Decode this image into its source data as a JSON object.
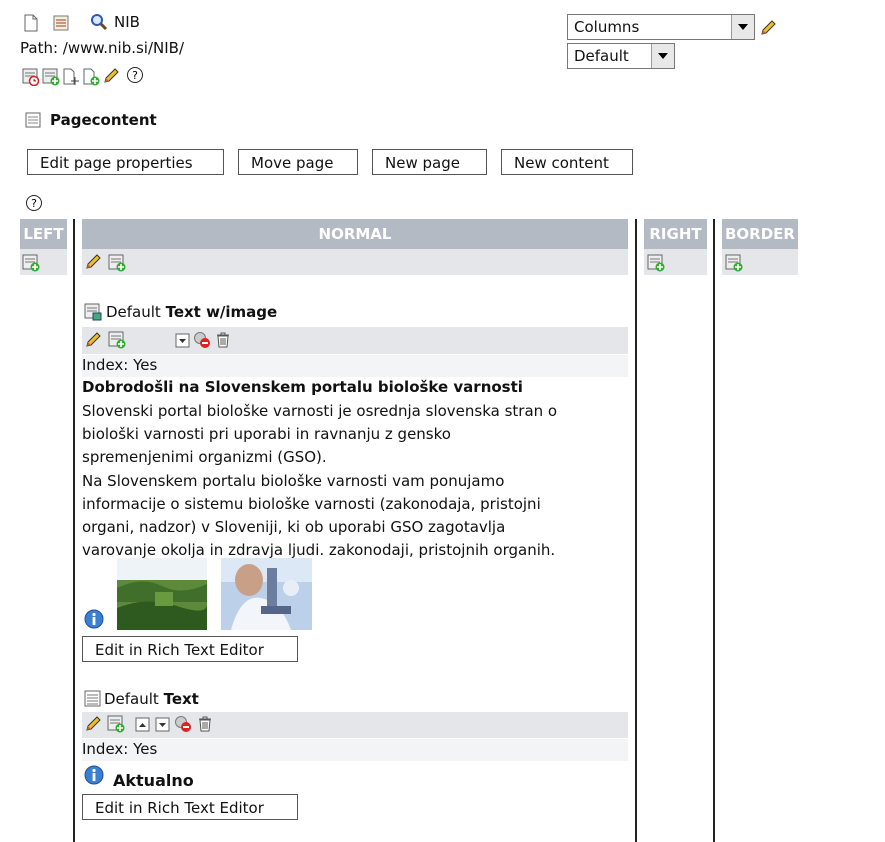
{
  "header": {
    "title": "NIB",
    "path": "Path: /www.nib.si/NIB/",
    "columns_select": "Columns",
    "language_select": "Default",
    "section": "Pagecontent"
  },
  "buttons": {
    "edit_page": "Edit page properties",
    "move_page": "Move page",
    "new_page": "New page",
    "new_content": "New content"
  },
  "columns": {
    "left": "LEFT",
    "normal": "NORMAL",
    "right": "RIGHT",
    "border": "BORDER"
  },
  "element1": {
    "type_prefix": "Default",
    "type_name": "Text w/image",
    "index": "Index: Yes",
    "heading": "Dobrodošli na Slovenskem portalu biološke varnosti",
    "para1_l1": "Slovenski portal biološke varnosti je osrednja slovenska stran o",
    "para1_l2": "biološki varnosti pri uporabi in ravnanju z gensko",
    "para1_l3": "spremenjenimi organizmi (GSO).",
    "para2_l1": "Na Slovenskem portalu biološke varnosti vam ponujamo",
    "para2_l2": "informacije o sistemu biološke varnosti (zakonodaja, pristojni",
    "para2_l3": "organi, nadzor) v Sloveniji, ki ob uporabi GSO zagotavlja",
    "para2_l4": "varovanje okolja in zdravja ljudi. zakonodaji, pristojnih organih.",
    "rte_button": "Edit in Rich Text Editor"
  },
  "element2": {
    "type_prefix": "Default",
    "type_name": "Text",
    "index": "Index: Yes",
    "heading": "Aktualno",
    "rte_button": "Edit in Rich Text Editor"
  },
  "colors": {
    "column_header": "#b4bac3",
    "icon_bar": "#e4e6ea",
    "info_blue": "#3a7fd0"
  }
}
